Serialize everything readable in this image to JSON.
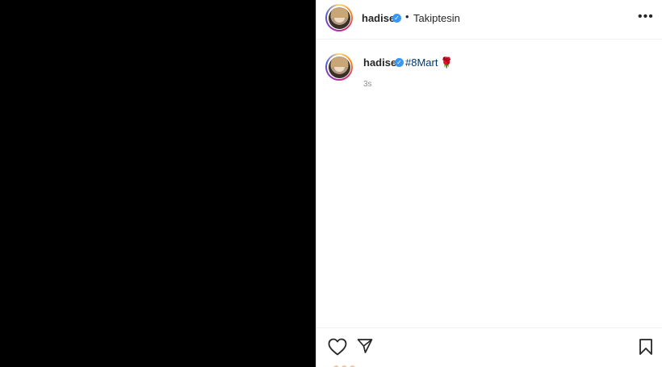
{
  "header": {
    "username": "hadise",
    "verified_icon": "verified-badge-icon",
    "separator": "•",
    "follow_status": "Takiptesin",
    "more_icon": "more-options-icon",
    "more_glyph": "•••"
  },
  "comment": {
    "username": "hadise",
    "verified_icon": "verified-badge-icon",
    "hashtag": "#8Mart",
    "emoji": "🌹",
    "timestamp": "3s"
  },
  "actions": {
    "like_icon": "heart-icon",
    "share_icon": "send-icon",
    "save_icon": "bookmark-icon"
  },
  "colors": {
    "media_bg": "#000000",
    "hashtag": "#00376b",
    "verified": "#3897f0",
    "muted_text": "#8e8e8e"
  }
}
